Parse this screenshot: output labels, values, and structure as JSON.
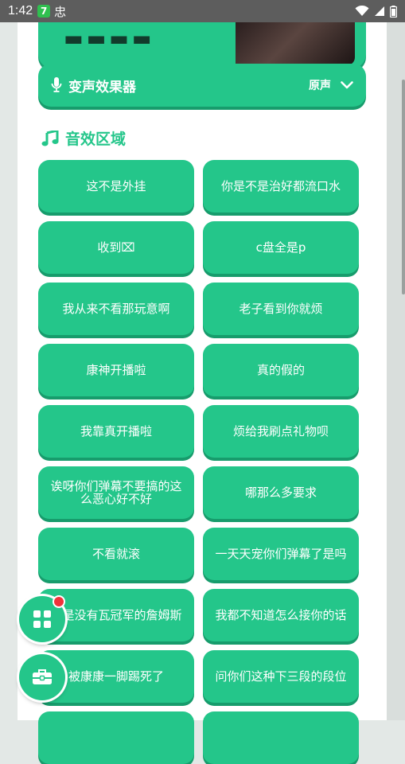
{
  "status_bar": {
    "time": "1:42",
    "badge": "7",
    "extra": "忠"
  },
  "voice_changer": {
    "title": "变声效果器",
    "value": "原声"
  },
  "section": {
    "title": "音效区域"
  },
  "sound_effects": [
    "这不是外挂",
    "你是不是治好都流口水",
    "收到⌧",
    "c盘全是p",
    "我从来不看那玩意啊",
    "老子看到你就烦",
    "康神开播啦",
    "真的假的",
    "我靠真开播啦",
    "烦给我刷点礼物呗",
    "诶呀你们弹幕不要搞的这么恶心好不好",
    "哪那么多要求",
    "不看就滚",
    "一天天宠你们弹幕了是吗",
    "哥是没有瓦冠军的詹姆斯",
    "我都不知道怎么接你的话",
    "被康康一脚踢死了",
    "问你们这种下三段的段位",
    "",
    ""
  ],
  "colors": {
    "accent": "#24c68a",
    "accent_shadow": "#179c6c",
    "notification": "#f0333b"
  },
  "icons": {
    "voice": "microphone-icon",
    "dropdown": "chevron-down-icon",
    "section": "music-note-icon",
    "fab_apps": "grid-icon",
    "fab_tools": "toolbox-icon"
  }
}
